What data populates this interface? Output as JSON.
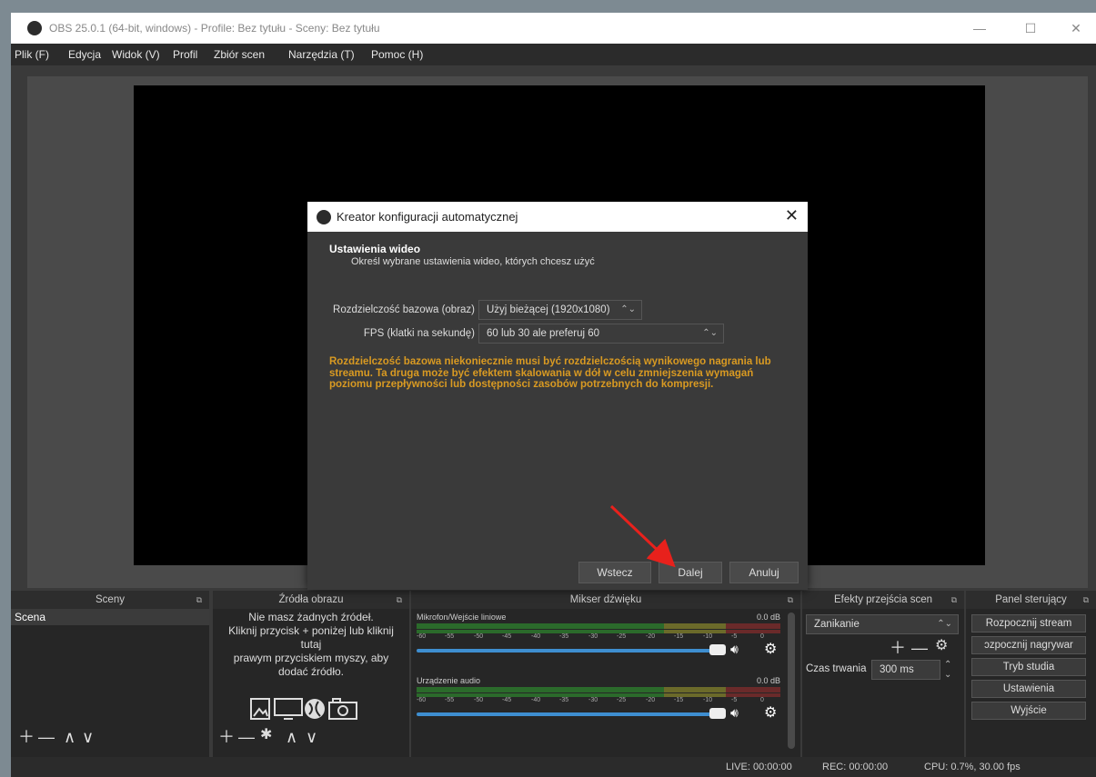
{
  "window": {
    "title": "OBS 25.0.1 (64-bit, windows) - Profile: Bez tytułu - Sceny: Bez tytułu",
    "minimize": "—",
    "maximize": "☐",
    "close": "✕"
  },
  "menu": [
    "Plik (F)",
    "Edycja",
    "Widok (V)",
    "Profil",
    "Zbiór scen",
    "Narzędzia (T)",
    "Pomoc (H)"
  ],
  "docks": {
    "scenes": {
      "title": "Sceny",
      "items": [
        "Scena"
      ]
    },
    "sources": {
      "title": "Źródła obrazu",
      "empty_lines": [
        "Nie masz żadnych źródeł.",
        "Kliknij przycisk + poniżej lub kliknij",
        "tutaj",
        "prawym przyciskiem myszy, aby",
        "dodać źródło."
      ]
    },
    "mixer": {
      "title": "Mikser dźwięku",
      "channels": [
        {
          "name": "Mikrofon/Wejście liniowe",
          "db": "0.0 dB"
        },
        {
          "name": "Urządzenie audio",
          "db": "0.0 dB"
        }
      ],
      "ticks": [
        "-60",
        "-55",
        "-50",
        "-45",
        "-40",
        "-35",
        "-30",
        "-25",
        "-20",
        "-15",
        "-10",
        "-5",
        "0"
      ]
    },
    "transitions": {
      "title": "Efekty przejścia scen",
      "selected": "Zanikanie",
      "duration_label": "Czas trwania",
      "duration_value": "300 ms"
    },
    "controls": {
      "title": "Panel sterujący",
      "buttons": [
        "Rozpocznij stream",
        "ɔzpocznij nagrywar",
        "Tryb studia",
        "Ustawienia",
        "Wyjście"
      ]
    }
  },
  "statusbar": {
    "live": "LIVE: 00:00:00",
    "rec": "REC: 00:00:00",
    "cpu": "CPU: 0.7%, 30.00 fps"
  },
  "dialog": {
    "title": "Kreator konfiguracji automatycznej",
    "header": "Ustawienia wideo",
    "subheader": "Określ wybrane ustawienia wideo, których chcesz użyć",
    "resolution_label": "Rozdzielczość bazowa (obraz)",
    "resolution_value": "Użyj bieżącej (1920x1080)",
    "fps_label": "FPS (klatki na sekundę)",
    "fps_value": "60 lub 30 ale preferuj 60",
    "warning": "Rozdzielczość bazowa niekoniecznie musi być rozdzielczością wynikowego nagrania lub streamu. Ta druga może być efektem skalowania w dół w celu zmniejszenia wymagań poziomu przepływności lub dostępności zasobów potrzebnych do kompresji.",
    "back": "Wstecz",
    "next": "Dalej",
    "cancel": "Anuluj"
  },
  "colors": {
    "warning": "#d99a22",
    "annotation_arrow": "#e8211c",
    "slider": "#3e8ed0"
  }
}
